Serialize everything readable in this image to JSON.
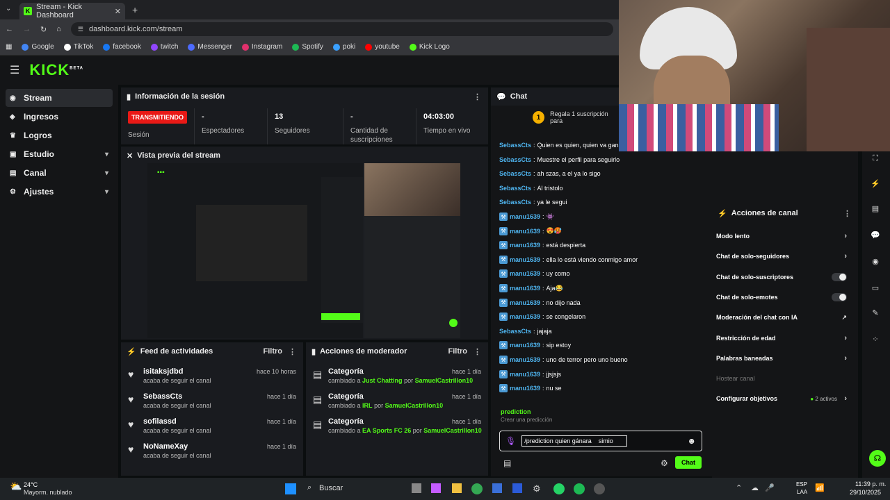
{
  "browser": {
    "tab_title": "Stream - Kick Dashboard",
    "url": "dashboard.kick.com/stream",
    "bookmarks": [
      {
        "label": "Google",
        "color": "#4285f4"
      },
      {
        "label": "TikTok",
        "color": "#ffffff"
      },
      {
        "label": "facebook",
        "color": "#1877f2"
      },
      {
        "label": "twitch",
        "color": "#9146ff"
      },
      {
        "label": "Messenger",
        "color": "#4d6bff"
      },
      {
        "label": "Instagram",
        "color": "#e1306c"
      },
      {
        "label": "Spotify",
        "color": "#1db954"
      },
      {
        "label": "poki",
        "color": "#3aa0ff"
      },
      {
        "label": "youtube",
        "color": "#ff0000"
      },
      {
        "label": "Kick Logo",
        "color": "#53fc18"
      }
    ]
  },
  "header": {
    "logo": "KICK",
    "logo_sup": "BETA"
  },
  "sidebar": {
    "items": [
      {
        "label": "Stream",
        "icon": "signal-icon"
      },
      {
        "label": "Ingresos",
        "icon": "revenue-icon"
      },
      {
        "label": "Logros",
        "icon": "trophy-icon"
      },
      {
        "label": "Estudio",
        "icon": "studio-icon"
      },
      {
        "label": "Canal",
        "icon": "channel-icon"
      },
      {
        "label": "Ajustes",
        "icon": "gear-icon"
      }
    ]
  },
  "session": {
    "title": "Información de la sesión",
    "live_badge": "TRANSMITIENDO",
    "session_label": "Sesión",
    "stats": [
      {
        "value": "-",
        "label": "Espectadores"
      },
      {
        "value": "13",
        "label": "Seguidores"
      },
      {
        "value": "-",
        "label": "Cantidad de suscripciones"
      },
      {
        "value": "04:03:00",
        "label": "Tiempo en vivo"
      }
    ]
  },
  "preview": {
    "title": "Vista previa del stream"
  },
  "activity": {
    "title": "Feed de actividades",
    "filter": "Filtro",
    "items": [
      {
        "name": "isitaksjdbd",
        "desc": "acaba de seguir el canal",
        "time": "hace 10 horas"
      },
      {
        "name": "SebassCts",
        "desc": "acaba de seguir el canal",
        "time": "hace 1 día"
      },
      {
        "name": "sofilassd",
        "desc": "acaba de seguir el canal",
        "time": "hace 1 día"
      },
      {
        "name": "NoNameXay",
        "desc": "acaba de seguir el canal",
        "time": "hace 1 día"
      }
    ]
  },
  "mod": {
    "title": "Acciones de moderador",
    "filter": "Filtro",
    "items": [
      {
        "name": "Categoría",
        "pre": "cambiado a",
        "cat": "Just Chatting",
        "por": "por",
        "user": "SamuelCastrillon10",
        "time": "hace 1 día"
      },
      {
        "name": "Categoría",
        "pre": "cambiado a",
        "cat": "IRL",
        "por": "por",
        "user": "SamuelCastrillon10",
        "time": "hace 1 día"
      },
      {
        "name": "Categoría",
        "pre": "cambiado a",
        "cat": "EA Sports FC 26",
        "por": "por",
        "user": "SamuelCastrillon10",
        "time": "hace 1 día"
      }
    ]
  },
  "chat": {
    "title": "Chat",
    "pinned": "Regala 1 suscripción para",
    "pinned_num": "1",
    "messages": [
      {
        "user": "SebassCts",
        "text": "Quien es quien, quien va ganar",
        "color": "#4fb5f0",
        "badge": false
      },
      {
        "user": "SebassCts",
        "text": "Muestre el perfil para seguirlo",
        "color": "#4fb5f0",
        "badge": false
      },
      {
        "user": "SebassCts",
        "text": "ah szas, a el ya lo sigo",
        "color": "#4fb5f0",
        "badge": false
      },
      {
        "user": "SebassCts",
        "text": "Al tristolo",
        "color": "#4fb5f0",
        "badge": false
      },
      {
        "user": "SebassCts",
        "text": "ya le segui",
        "color": "#4fb5f0",
        "badge": false
      },
      {
        "user": "manu1639",
        "text": "👾",
        "color": "#4fb5f0",
        "badge": true
      },
      {
        "user": "manu1639",
        "text": "😍🥵",
        "color": "#4fb5f0",
        "badge": true
      },
      {
        "user": "manu1639",
        "text": "está despierta",
        "color": "#4fb5f0",
        "badge": true
      },
      {
        "user": "manu1639",
        "text": "ella lo está viendo conmigo amor",
        "color": "#4fb5f0",
        "badge": true
      },
      {
        "user": "manu1639",
        "text": "uy como",
        "color": "#4fb5f0",
        "badge": true
      },
      {
        "user": "manu1639",
        "text": "Aja😂",
        "color": "#4fb5f0",
        "badge": true
      },
      {
        "user": "manu1639",
        "text": "no dijo nada",
        "color": "#4fb5f0",
        "badge": true
      },
      {
        "user": "manu1639",
        "text": "se congelaron",
        "color": "#4fb5f0",
        "badge": true
      },
      {
        "user": "SebassCts",
        "text": "jajaja",
        "color": "#4fb5f0",
        "badge": false
      },
      {
        "user": "manu1639",
        "text": "sip estoy",
        "color": "#4fb5f0",
        "badge": true
      },
      {
        "user": "manu1639",
        "text": "uno de terror pero uno bueno",
        "color": "#4fb5f0",
        "badge": true
      },
      {
        "user": "manu1639",
        "text": "jjsjsjs",
        "color": "#4fb5f0",
        "badge": true
      },
      {
        "user": "manu1639",
        "text": "nu se",
        "color": "#4fb5f0",
        "badge": true
      }
    ],
    "suggest_cmd": "prediction",
    "suggest_desc": "Crear una predicción",
    "input_value": "/prediction quien gánara    simio",
    "send_label": "Chat"
  },
  "actions": {
    "title": "Acciones de canal",
    "items": [
      {
        "label": "Modo lento",
        "kind": "chevron"
      },
      {
        "label": "Chat de solo-seguidores",
        "kind": "chevron"
      },
      {
        "label": "Chat de solo-suscriptores",
        "kind": "toggle"
      },
      {
        "label": "Chat de solo-emotes",
        "kind": "toggle"
      },
      {
        "label": "Moderación del chat con IA",
        "kind": "link"
      },
      {
        "label": "Restricción de edad",
        "kind": "chevron"
      },
      {
        "label": "Palabras baneadas",
        "kind": "chevron"
      },
      {
        "label": "Hostear canal",
        "kind": "disabled"
      },
      {
        "label": "Configurar objetivos",
        "kind": "chevron"
      }
    ],
    "goals_active": "2 activos"
  },
  "taskbar": {
    "weather_temp": "24°C",
    "weather_desc": "Mayorm. nublado",
    "search": "Buscar",
    "lang1": "ESP",
    "lang2": "LAA",
    "time": "11:39 p. m.",
    "date": "29/10/2025"
  }
}
